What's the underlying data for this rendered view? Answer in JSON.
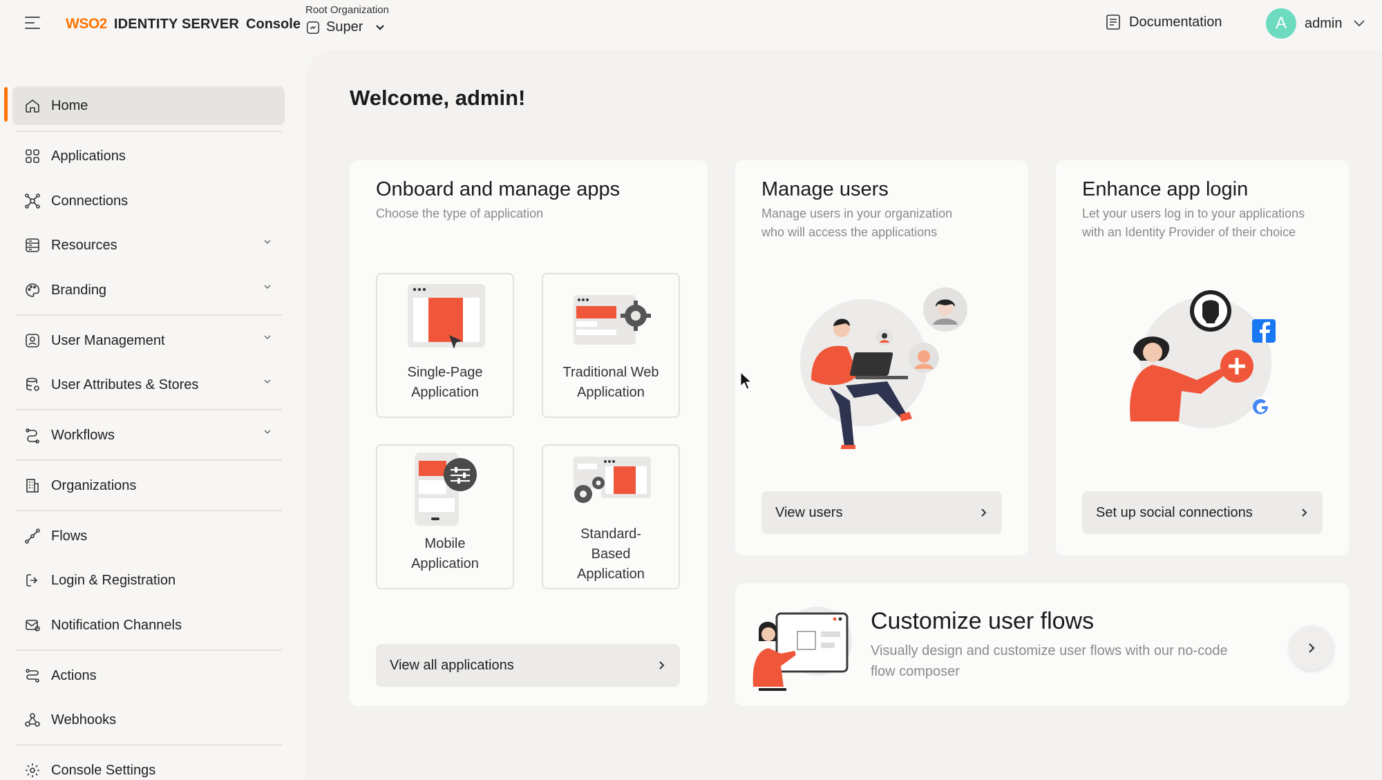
{
  "header": {
    "logo_mark": "WSO2",
    "product": "IDENTITY SERVER",
    "console": "Console",
    "org_label": "Root Organization",
    "org_value": "Super",
    "docs_label": "Documentation",
    "avatar_letter": "A",
    "user_name": "admin"
  },
  "sidebar": {
    "items": [
      {
        "label": "Home",
        "icon": "home-icon",
        "active": true
      },
      {
        "label": "Applications",
        "icon": "grid-icon"
      },
      {
        "label": "Connections",
        "icon": "connections-icon"
      },
      {
        "label": "Resources",
        "icon": "server-icon",
        "expandable": true
      },
      {
        "label": "Branding",
        "icon": "palette-icon",
        "expandable": true
      },
      {
        "label": "User Management",
        "icon": "user-icon",
        "expandable": true
      },
      {
        "label": "User Attributes & Stores",
        "icon": "database-icon",
        "expandable": true
      },
      {
        "label": "Workflows",
        "icon": "workflow-icon",
        "expandable": true
      },
      {
        "label": "Organizations",
        "icon": "building-icon"
      },
      {
        "label": "Flows",
        "icon": "flows-icon"
      },
      {
        "label": "Login & Registration",
        "icon": "login-icon"
      },
      {
        "label": "Notification Channels",
        "icon": "mail-icon"
      },
      {
        "label": "Actions",
        "icon": "actions-icon"
      },
      {
        "label": "Webhooks",
        "icon": "webhook-icon"
      },
      {
        "label": "Console Settings",
        "icon": "gear-icon"
      }
    ]
  },
  "main": {
    "welcome": "Welcome, admin!",
    "onboard": {
      "title": "Onboard and manage apps",
      "subtitle": "Choose the type of application",
      "tiles": [
        {
          "line1": "Single-Page",
          "line2": "Application"
        },
        {
          "line1": "Traditional Web",
          "line2": "Application"
        },
        {
          "line1": "Mobile",
          "line2": "Application"
        },
        {
          "line1": "Standard-",
          "line2": "Based",
          "line3": "Application"
        }
      ],
      "button": "View all applications"
    },
    "users": {
      "title": "Manage users",
      "subtitle1": "Manage users in your organization",
      "subtitle2": "who will access the applications",
      "button": "View users"
    },
    "login": {
      "title": "Enhance app login",
      "subtitle1": "Let your users log in to your applications",
      "subtitle2": "with an Identity Provider of their choice",
      "button": "Set up social connections"
    },
    "flows": {
      "title": "Customize user flows",
      "subtitle1": "Visually design and customize user flows with our no-code",
      "subtitle2": "flow composer"
    }
  },
  "colors": {
    "accent": "#ff7300",
    "illustration_red": "#f0563a",
    "avatar": "#6ddbc0"
  }
}
